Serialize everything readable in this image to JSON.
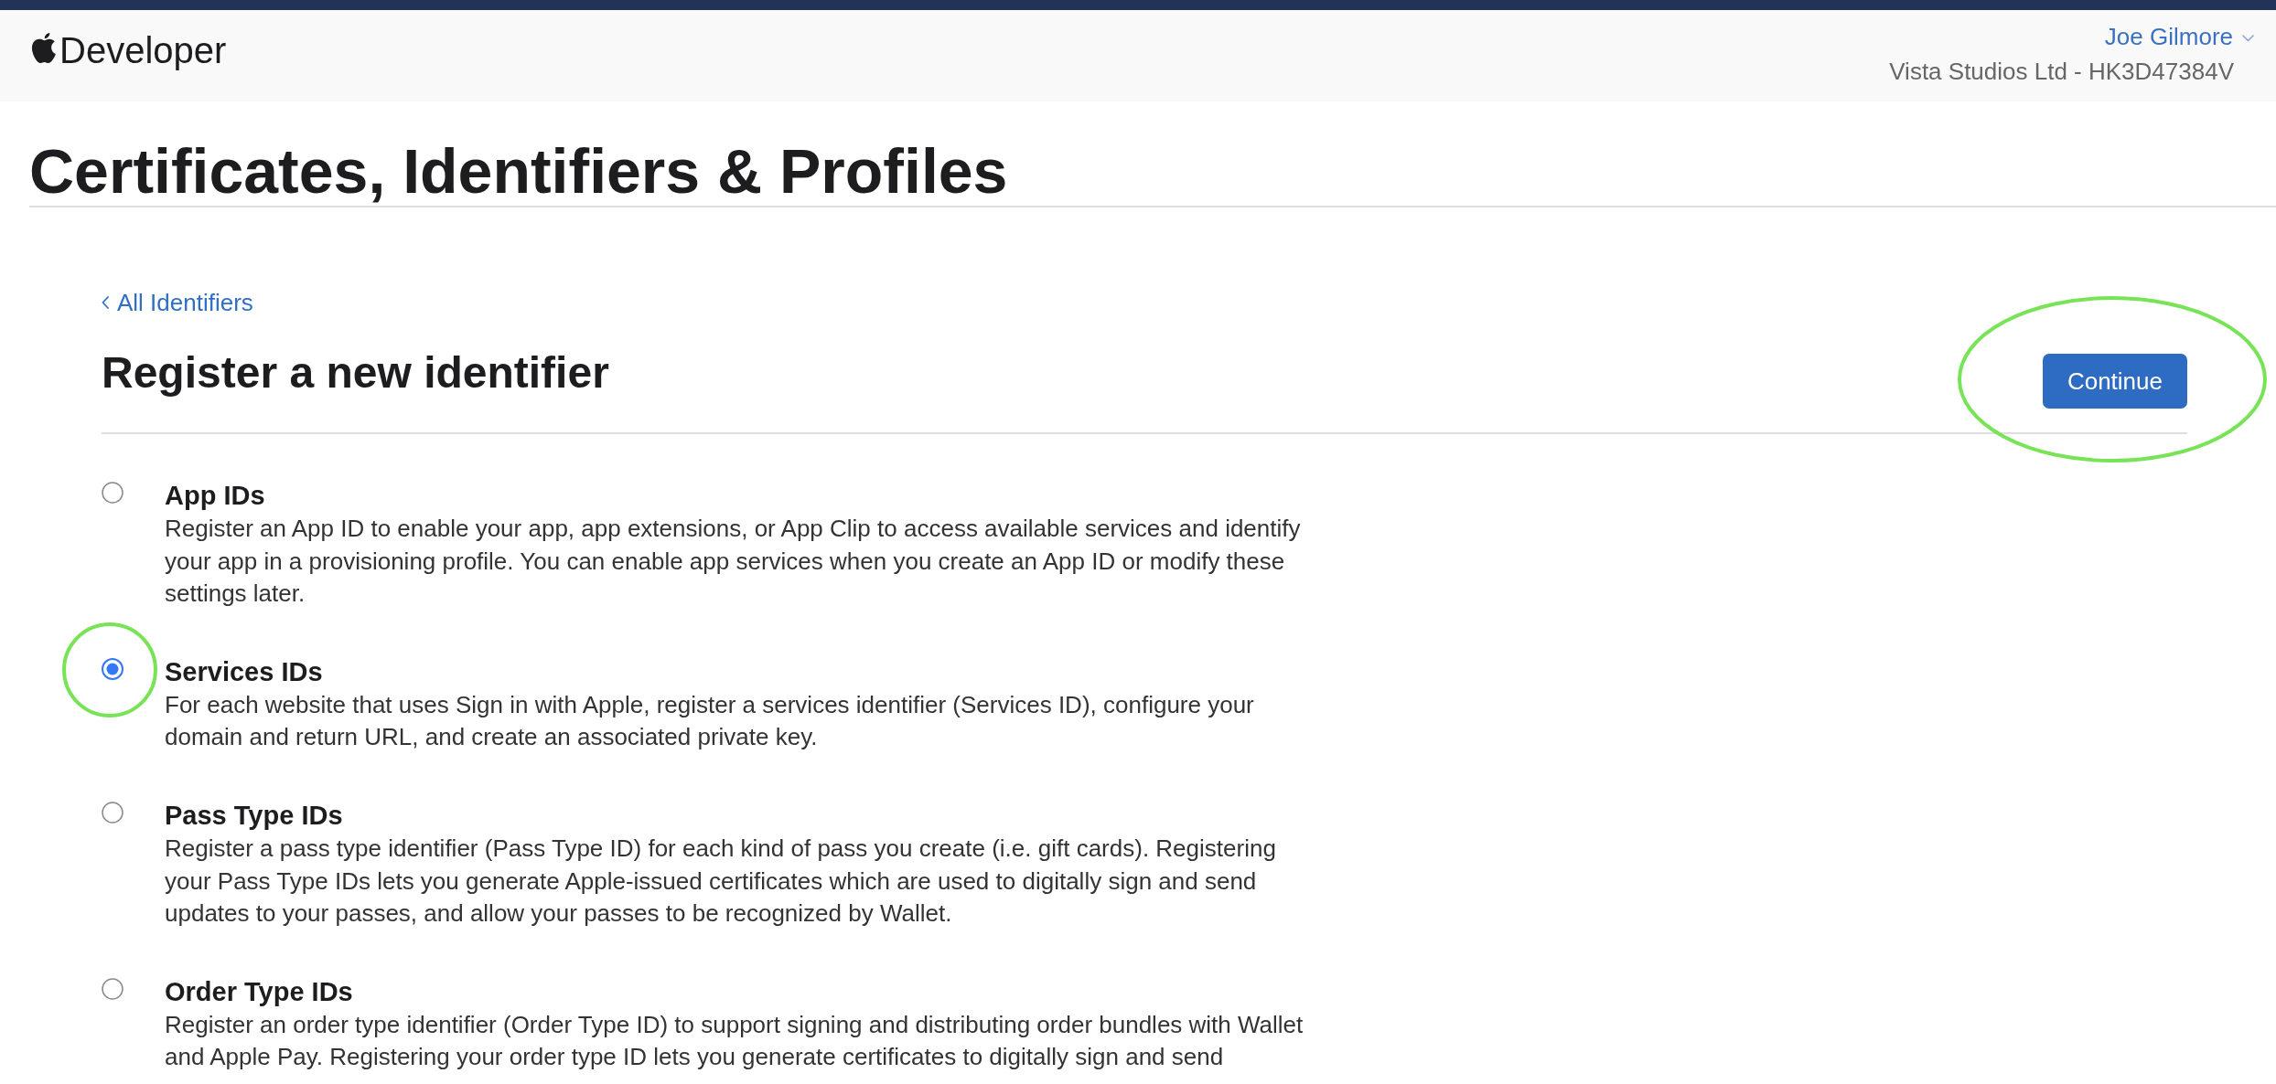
{
  "header": {
    "logo_text": "Developer",
    "account": {
      "name": "Joe Gilmore",
      "team": "Vista Studios Ltd - HK3D47384V"
    }
  },
  "page_title": "Certificates, Identifiers & Profiles",
  "back_link": {
    "label": "All Identifiers"
  },
  "form": {
    "title": "Register a new identifier",
    "continue_button": {
      "label": "Continue",
      "highlighted": true
    },
    "options": [
      {
        "title": "App IDs",
        "description": "Register an App ID to enable your app, app extensions, or App Clip to access available services and identify your app in a provisioning profile. You can enable app services when you create an App ID or modify these settings later.",
        "selected": false,
        "highlighted": false
      },
      {
        "title": "Services IDs",
        "description": "For each website that uses Sign in with Apple, register a services identifier (Services ID), configure your domain and return URL, and create an associated private key.",
        "selected": true,
        "highlighted": true
      },
      {
        "title": "Pass Type IDs",
        "description": "Register a pass type identifier (Pass Type ID) for each kind of pass you create (i.e. gift cards). Registering your Pass Type IDs lets you generate Apple-issued certificates which are used to digitally sign and send updates to your passes, and allow your passes to be recognized by Wallet.",
        "selected": false,
        "highlighted": false
      },
      {
        "title": "Order Type IDs",
        "description": "Register an order type identifier (Order Type ID) to support signing and distributing order bundles with Wallet and Apple Pay. Registering your order type ID lets you generate certificates to digitally sign and send",
        "selected": false,
        "highlighted": false
      }
    ]
  }
}
